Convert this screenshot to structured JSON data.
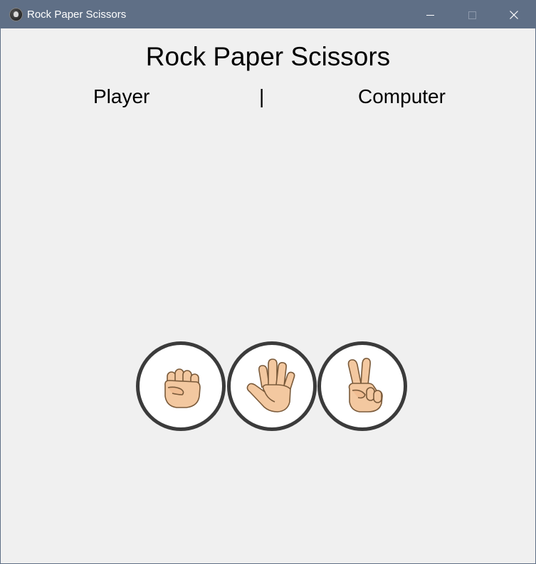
{
  "window": {
    "title": "Rock Paper Scissors",
    "icon": "app-icon",
    "controls": [
      "minimize-icon",
      "maximize-icon",
      "close-icon"
    ]
  },
  "game": {
    "heading": "Rock Paper Scissors",
    "player_label": "Player",
    "separator": "|",
    "computer_label": "Computer"
  },
  "choices": [
    {
      "id": "rock",
      "icon": "fist-icon"
    },
    {
      "id": "paper",
      "icon": "open-hand-icon"
    },
    {
      "id": "scissors",
      "icon": "victory-hand-icon"
    }
  ],
  "colors": {
    "titlebar": "#5f6f86",
    "background": "#f0f0f0",
    "button_border": "#3b3b3b",
    "button_fill": "#ffffff",
    "skin": "#f3c8a0",
    "skin_outline": "#7a5a3a"
  }
}
